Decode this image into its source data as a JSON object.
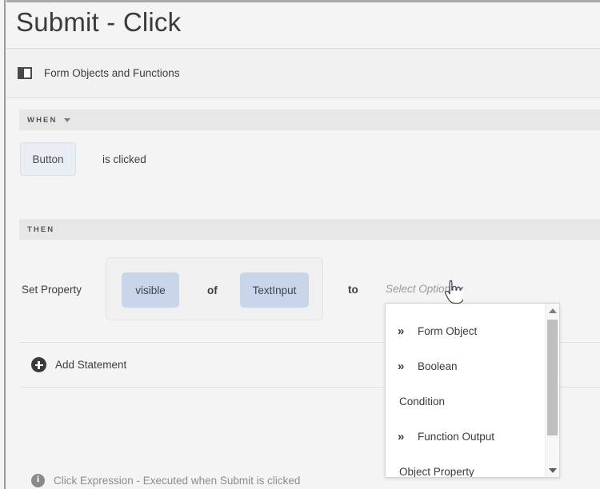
{
  "page": {
    "title": "Submit - Click"
  },
  "section": {
    "label": "Form Objects and Functions",
    "icon": "panel-icon"
  },
  "when": {
    "band_label": "WHEN",
    "chevron_icon": "chevron-down-icon",
    "object_chip": "Button",
    "event_text": "is clicked"
  },
  "then": {
    "band_label": "THEN",
    "action_label": "Set Property",
    "property_chip": "visible",
    "connector_of": "of",
    "object_chip": "TextInput",
    "connector_to": "to",
    "value_placeholder": "Select Option"
  },
  "dropdown": {
    "items": [
      {
        "label": "Form Object",
        "has_chevrons": true,
        "chevrons": "»"
      },
      {
        "label": "Boolean",
        "has_chevrons": true,
        "chevrons": "»"
      },
      {
        "label": "Condition",
        "has_chevrons": false,
        "chevrons": ""
      },
      {
        "label": "Function Output",
        "has_chevrons": true,
        "chevrons": "»"
      },
      {
        "label": "Object Property",
        "has_chevrons": false,
        "chevrons": ""
      }
    ],
    "scrollbar": {
      "up_arrow": "scroll-up-arrow",
      "down_arrow": "scroll-down-arrow"
    }
  },
  "add_statement": {
    "label": "Add Statement",
    "icon": "plus-circle-icon"
  },
  "footer": {
    "label": "Click Expression - Executed when Submit is clicked",
    "icon": "info-icon"
  },
  "cursor": {
    "type": "pointing-hand"
  },
  "colors": {
    "background": "#f4f4f4",
    "band": "#e7e7e7",
    "chip_blue": "#c9d5e8",
    "chip_gray": "#e9eef4",
    "text": "#3d3d3d",
    "placeholder": "#9a9a9a"
  }
}
